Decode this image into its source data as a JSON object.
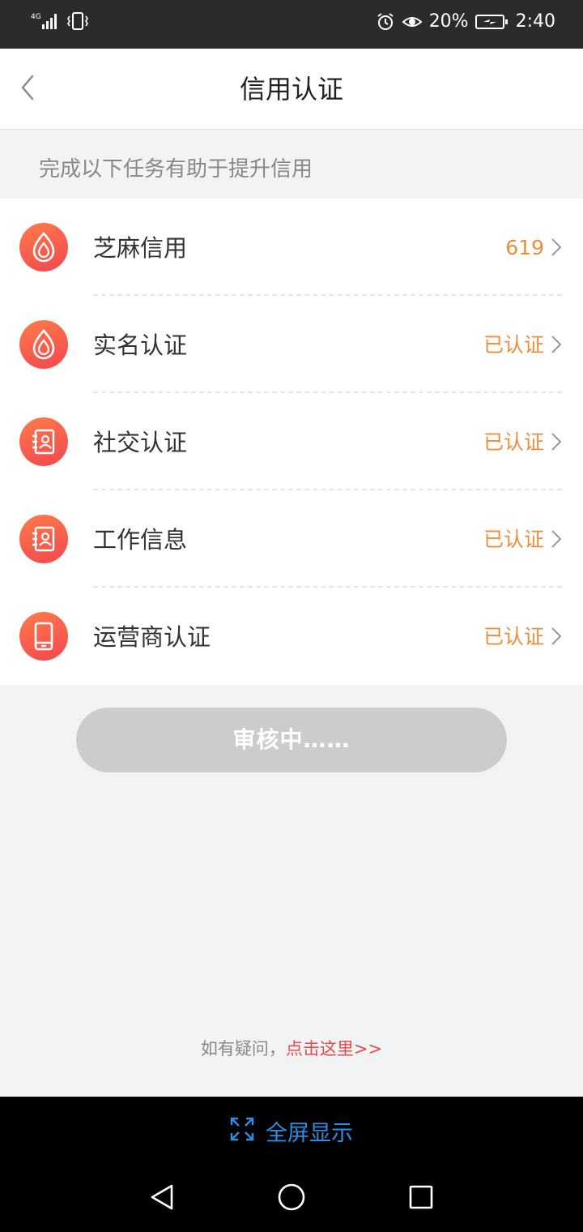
{
  "status_bar": {
    "network": "4G",
    "battery_percent": "20%",
    "time": "2:40"
  },
  "header": {
    "title": "信用认证"
  },
  "hint": "完成以下任务有助于提升信用",
  "items": [
    {
      "label": "芝麻信用",
      "status": "619",
      "icon": "sesame-icon"
    },
    {
      "label": "实名认证",
      "status": "已认证",
      "icon": "sesame-icon"
    },
    {
      "label": "社交认证",
      "status": "已认证",
      "icon": "contact-book-icon"
    },
    {
      "label": "工作信息",
      "status": "已认证",
      "icon": "contact-book-icon"
    },
    {
      "label": "运营商认证",
      "status": "已认证",
      "icon": "phone-icon"
    }
  ],
  "audit_button": "审核中……",
  "help": {
    "prefix": "如有疑问，",
    "link": "点击这里>>"
  },
  "fullscreen_label": "全屏显示",
  "colors": {
    "accent_orange": "#ef8c3a",
    "icon_gradient_start": "#ff7b4a",
    "icon_gradient_end": "#f2474f",
    "link_red": "#e8494b",
    "fullscreen_blue": "#2d8ee6"
  }
}
